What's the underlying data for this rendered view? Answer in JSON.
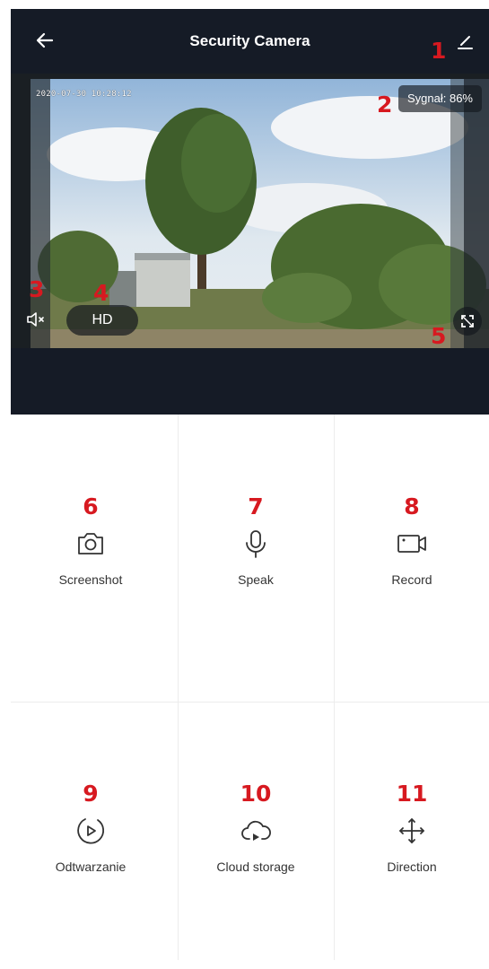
{
  "header": {
    "title": "Security Camera"
  },
  "video": {
    "timestamp": "2020-07-30 10:28:12",
    "signal_text": "Sygnał: 86%",
    "quality_label": "HD"
  },
  "controls": [
    {
      "label": "Screenshot",
      "number": "6",
      "icon": "camera-icon"
    },
    {
      "label": "Speak",
      "number": "7",
      "icon": "microphone-icon"
    },
    {
      "label": "Record",
      "number": "8",
      "icon": "video-record-icon"
    },
    {
      "label": "Odtwarzanie",
      "number": "9",
      "icon": "playback-icon"
    },
    {
      "label": "Cloud storage",
      "number": "10",
      "icon": "cloud-storage-icon"
    },
    {
      "label": "Direction",
      "number": "11",
      "icon": "direction-arrows-icon"
    }
  ],
  "annotations": [
    "1",
    "2",
    "3",
    "4",
    "5"
  ],
  "colors": {
    "header_bg": "#151b26",
    "annotation_red": "#d71920"
  }
}
